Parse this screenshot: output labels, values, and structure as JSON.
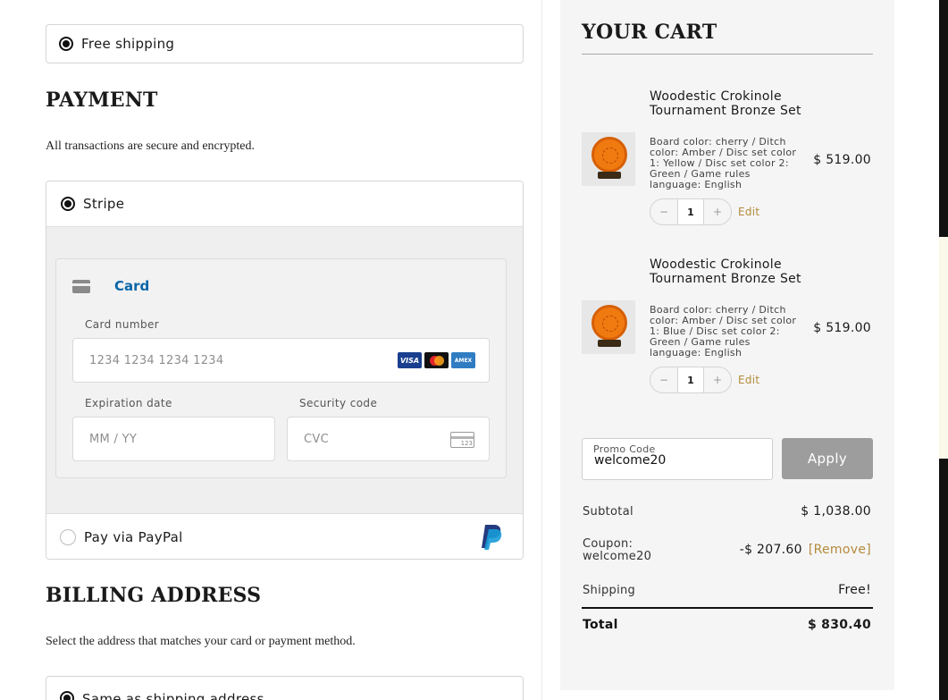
{
  "shipping": {
    "option_label": "Free shipping"
  },
  "payment": {
    "title": "PAYMENT",
    "subtitle": "All transactions are secure and encrypted.",
    "stripe_label": "Stripe",
    "card_tab_label": "Card",
    "card_number_label": "Card number",
    "card_number_placeholder": "1234 1234 1234 1234",
    "card_brands": [
      "VISA",
      "mastercard",
      "AMEX"
    ],
    "expiration_label": "Expiration date",
    "expiration_placeholder": "MM / YY",
    "security_label": "Security code",
    "security_placeholder": "CVC",
    "cvc_icon_text": "123",
    "paypal_label": "Pay via PayPal"
  },
  "billing": {
    "title": "BILLING ADDRESS",
    "subtitle": "Select the address that matches your card or payment method.",
    "same_as_shipping_label": "Same as shipping address"
  },
  "cart": {
    "title": "YOUR CART",
    "items": [
      {
        "name": "Woodestic Crokinole Tournament Bronze Set",
        "options": "Board color: cherry / Ditch color: Amber / Disc set color 1: Yellow / Disc set color 2: Green / Game rules language: English",
        "price": "$ 519.00",
        "qty": "1",
        "minus": "−",
        "plus": "+",
        "edit_label": "Edit"
      },
      {
        "name": "Woodestic Crokinole Tournament Bronze Set",
        "options": "Board color: cherry / Ditch color: Amber / Disc set color 1: Blue / Disc set color 2: Green / Game rules language: English",
        "price": "$ 519.00",
        "qty": "1",
        "minus": "−",
        "plus": "+",
        "edit_label": "Edit"
      }
    ],
    "promo": {
      "label": "Promo Code",
      "value": "welcome20",
      "apply_label": "Apply"
    },
    "summary": {
      "subtotal_label": "Subtotal",
      "subtotal_value": "$ 1,038.00",
      "coupon_label": "Coupon: welcome20",
      "coupon_value": "-$ 207.60",
      "remove_label": "[Remove]",
      "shipping_label": "Shipping",
      "shipping_value": "Free!",
      "total_label": "Total",
      "total_value": "$ 830.40"
    }
  },
  "colors": {
    "accent_link": "#b48a3c",
    "card_tab_blue": "#0a66a8",
    "apply_button": "#9d9d9d",
    "cart_bg": "#f5f5f5"
  }
}
